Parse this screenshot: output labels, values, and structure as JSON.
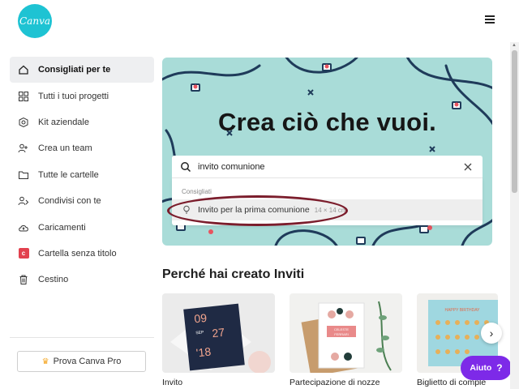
{
  "header": {
    "logo_text": "Canva"
  },
  "sidebar": {
    "items": [
      {
        "label": "Consigliati per te",
        "icon": "home-icon",
        "active": true
      },
      {
        "label": "Tutti i tuoi progetti",
        "icon": "grid-icon"
      },
      {
        "label": "Kit aziendale",
        "icon": "brand-kit-icon"
      },
      {
        "label": "Crea un team",
        "icon": "team-icon"
      },
      {
        "label": "Tutte le cartelle",
        "icon": "folder-icon"
      },
      {
        "label": "Condivisi con te",
        "icon": "shared-icon"
      },
      {
        "label": "Caricamenti",
        "icon": "upload-cloud-icon"
      },
      {
        "label": "Cartella senza titolo",
        "icon": "red-folder-icon"
      },
      {
        "label": "Cestino",
        "icon": "trash-icon"
      }
    ],
    "pro_button_label": "Prova Canva Pro"
  },
  "hero": {
    "title": "Crea ciò che vuoi.",
    "search": {
      "value": "invito comunione"
    },
    "dropdown": {
      "header": "Consigliati",
      "suggestion": "Invito per la prima comunione",
      "suggestion_size": "14 × 14 cm"
    },
    "accent_color": "#a9dcd8"
  },
  "section": {
    "title": "Perché hai creato Inviti",
    "cards": [
      {
        "label": "Invito",
        "image_text": [
          "09",
          "27",
          "'18",
          "SEP"
        ]
      },
      {
        "label": "Partecipazione di nozze",
        "image_text": [
          "CELESTE",
          "FERRARI"
        ]
      },
      {
        "label": "Biglietto di comple",
        "image_text": [
          "HAPPY BIRTHDAY"
        ]
      }
    ]
  },
  "help_button": {
    "label": "Aiuto",
    "icon": "?"
  },
  "colors": {
    "brand": "#1ec3d3",
    "help": "#7d2ae8",
    "highlight": "#7b1d2c"
  }
}
